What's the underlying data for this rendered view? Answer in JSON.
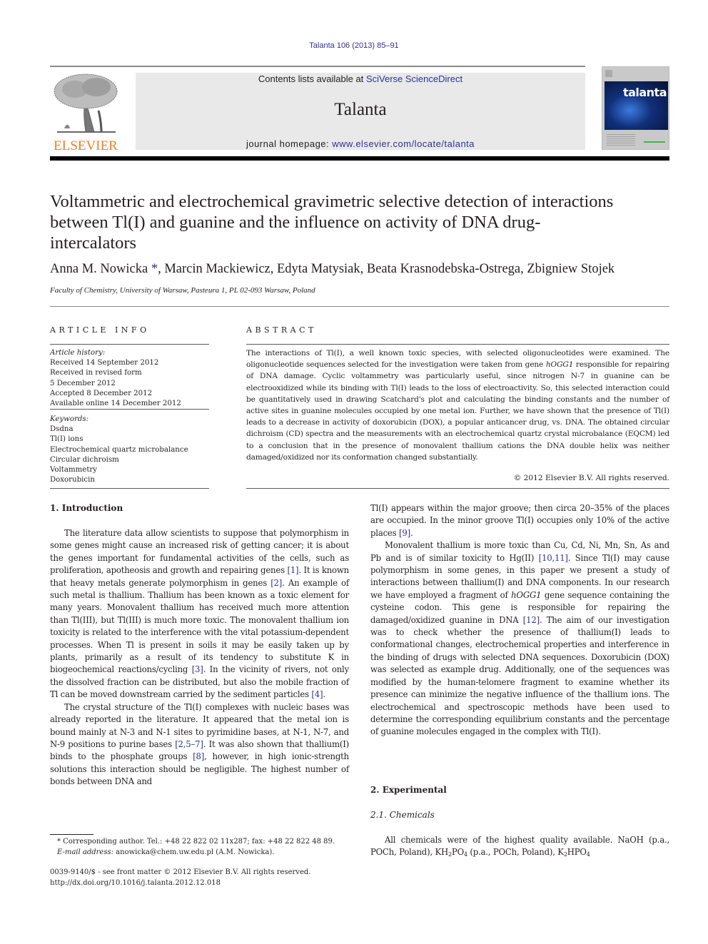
{
  "journal_header": {
    "citation": "Talanta 106 (2013) 85–91",
    "contents_prefix": "Contents lists available at ",
    "contents_link": "SciVerse ScienceDirect",
    "journal_name": "Talanta",
    "homepage_prefix": "journal homepage: ",
    "homepage_link": "www.elsevier.com/locate/talanta",
    "publisher_logo_text": "ELSEVIER",
    "cover_title": "talanta",
    "colors": {
      "link": "#2e3192",
      "elsevier_orange": "#f47b20",
      "banner_bg": "#e9e9e9"
    }
  },
  "article": {
    "title": "Voltammetric and electrochemical gravimetric selective detection of interactions between Tl(I) and guanine and the influence on activity of DNA drug-intercalators",
    "authors": [
      {
        "name": "Anna M. Nowicka",
        "mark": "*"
      },
      {
        "name": "Marcin Mackiewicz",
        "mark": ""
      },
      {
        "name": "Edyta Matysiak",
        "mark": ""
      },
      {
        "name": "Beata Krasnodebska-Ostrega",
        "mark": ""
      },
      {
        "name": "Zbigniew Stojek",
        "mark": ""
      }
    ],
    "author_1": "Anna M. Nowicka",
    "author_1_mark": " *",
    "authors_rest": ", Marcin Mackiewicz, Edyta Matysiak, Beata Krasnodebska-Ostrega, Zbigniew Stojek",
    "affiliation": "Faculty of Chemistry, University of Warsaw, Pasteura 1, PL 02-093 Warsaw, Poland"
  },
  "article_info": {
    "heading": "ARTICLE INFO",
    "history_label": "Article history:",
    "history": [
      "Received 14 September 2012",
      "Received in revised form",
      "5 December 2012",
      "Accepted 8 December 2012",
      "Available online 14 December 2012"
    ],
    "keywords_label": "Keywords:",
    "keywords": [
      "Dsdna",
      "Tl(I) ions",
      "Electrochemical quartz microbalance",
      "Circular dichroism",
      "Voltammetry",
      "Doxorubicin"
    ]
  },
  "abstract": {
    "heading": "ABSTRACT",
    "text_1": "The interactions of Tl(I), a well known toxic species, with selected oligonucleotides were examined. The oligonucleotide sequences selected for the investigation were taken from gene ",
    "gene": "hOGG1",
    "text_2": " responsible for repairing of DNA damage. Cyclic voltammetry was particularly useful, since nitrogen N-7 in guanine can be electrooxidized while its binding with Tl(I) leads to the loss of electroactivity. So, this selected interaction could be quantitatively used in drawing Scatchard's plot and calculating the binding constants and the number of active sites in guanine molecules occupied by one metal ion. Further, we have shown that the presence of Tl(I) leads to a decrease in activity of doxorubicin (DOX), a popular anticancer drug, vs. DNA. The obtained circular dichroism (CD) spectra and the measurements with an electrochemical quartz crystal microbalance (EQCM) led to a conclusion that in the presence of monovalent thallium cations the DNA double helix was neither damaged/oxidized nor its conformation changed substantially.",
    "copyright": "© 2012 Elsevier B.V. All rights reserved."
  },
  "sections": {
    "intro_heading": "1.  Introduction",
    "intro_p1": [
      {
        "t": "The literature data allow scientists to suppose that polymorphism in some genes might cause an increased risk of getting cancer; it is about the genes important for fundamental activities of the cells, such as proliferation, apotheosis and growth and repairing genes "
      },
      {
        "ref": "[1]"
      },
      {
        "t": ". It is known that heavy metals generate polymorphism in genes "
      },
      {
        "ref": "[2]"
      },
      {
        "t": ". An example of such metal is thallium. Thallium has been known as a toxic element for many years. Monovalent thallium has received much more attention than Tl(III), but Tl(III) is much more toxic. The monovalent thallium ion toxicity is related to the interference with the vital potassium-dependent processes. When Tl is present in soils it may be easily taken up by plants, primarily as a result of its tendency to substitute K in biogeochemical reactions/cycling "
      },
      {
        "ref": "[3]"
      },
      {
        "t": ". In the vicinity of rivers, not only the dissolved fraction can be distributed, but also the mobile fraction of Tl can be moved downstream carried by the sediment particles "
      },
      {
        "ref": "[4]"
      },
      {
        "t": "."
      }
    ],
    "intro_p2": [
      {
        "t": "The crystal structure of the Tl(I) complexes with nucleic bases was already reported in the literature. It appeared that the metal ion is bound mainly at N-3 and N-1 sites to pyrimidine bases, at N-1, N-7, and N-9 positions to purine bases "
      },
      {
        "ref": "[2,5–7]"
      },
      {
        "t": ". It was also shown that thallium(I) binds to the phosphate groups "
      },
      {
        "ref": "[8]"
      },
      {
        "t": ", however, in high ionic-strength solutions this interaction should be negligible. The highest number of bonds between DNA and"
      }
    ],
    "intro_p2_cont": [
      {
        "t": "Tl(I) appears within the major groove; then circa 20–35% of the places are occupied. In the minor groove Tl(I) occupies only 10% of the active places "
      },
      {
        "ref": "[9]"
      },
      {
        "t": "."
      }
    ],
    "intro_p3": [
      {
        "t": "Monovalent thallium is more toxic than Cu, Cd, Ni, Mn, Sn, As and Pb and is of similar toxicity to Hg(II) "
      },
      {
        "ref": "[10,11]"
      },
      {
        "t": ". Since Tl(I) may cause polymorphism in some genes, in this paper we present a study of interactions between thallium(I) and DNA components. In our research we have employed a fragment of "
      },
      {
        "i": "hOGG1"
      },
      {
        "t": " gene sequence containing the cysteine codon. This gene is responsible for repairing the damaged/oxidized guanine in DNA "
      },
      {
        "ref": "[12]"
      },
      {
        "t": ". The aim of our investigation was to check whether the presence of thallium(I) leads to conformational changes, electrochemical properties and interference in the binding of drugs with selected DNA sequences. Doxorubicin (DOX) was selected as example drug. Additionally, one of the sequences was modified by the human-telomere fragment to examine whether its presence can minimize the negative influence of the thallium ions. The electrochemical and spectroscopic methods have been used to determine the corresponding equilibrium constants and the percentage of guanine molecules engaged in the complex with Tl(I)."
      }
    ],
    "exp_heading": "2.  Experimental",
    "chem_heading": "2.1.  Chemicals",
    "chem_p1": [
      {
        "t": "All chemicals were of the highest quality available. NaOH (p.a., POCh, Poland), KH"
      },
      {
        "sub": "2"
      },
      {
        "t": "PO"
      },
      {
        "sub": "4"
      },
      {
        "t": " (p.a., POCh, Poland), K"
      },
      {
        "sub": "2"
      },
      {
        "t": "HPO"
      },
      {
        "sub": "4"
      }
    ]
  },
  "footnotes": {
    "corresponding": "* Corresponding author. Tel.: +48 22 822 02 11x287; fax: +48 22 822 48 89.",
    "email_label": "E-mail address:",
    "email": " anowicka@chem.uw.edu.pl (A.M. Nowicka).",
    "issn_line": "0039-9140/$ - see front matter © 2012 Elsevier B.V. All rights reserved.",
    "doi_line": "http://dx.doi.org/10.1016/j.talanta.2012.12.018"
  }
}
